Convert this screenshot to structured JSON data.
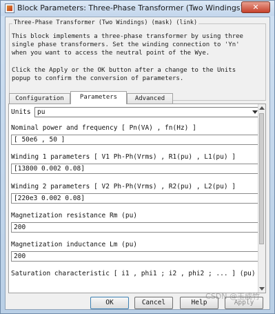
{
  "window": {
    "title": "Block Parameters: Three-Phase Transformer (Two Windings)",
    "close_glyph": "✕"
  },
  "group": {
    "legend": "Three-Phase Transformer (Two Windings) (mask) (link)",
    "description_1": "This block implements a three-phase transformer by using three\nsingle phase transformers. Set the winding connection to 'Yn'\nwhen you want to access the neutral point of the Wye.",
    "description_2": "Click the Apply or the OK button after a change to the Units\npopup to confirm the conversion of parameters."
  },
  "tabs": [
    {
      "label": "Configuration",
      "active": false
    },
    {
      "label": "Parameters",
      "active": true
    },
    {
      "label": "Advanced",
      "active": false
    }
  ],
  "units": {
    "label": "Units",
    "value": "pu"
  },
  "params": [
    {
      "label": "Nominal power and frequency  [ Pn(VA) , fn(Hz) ]",
      "value": "[ 50e6 , 50 ]"
    },
    {
      "label": "Winding 1 parameters [ V1 Ph-Ph(Vrms) , R1(pu) , L1(pu) ]",
      "value": "[13800 0.002 0.08]"
    },
    {
      "label": "Winding 2 parameters [ V2 Ph-Ph(Vrms) , R2(pu) , L2(pu) ]",
      "value": "[220e3 0.002 0.08]"
    },
    {
      "label": "Magnetization resistance  Rm (pu)",
      "value": "200"
    },
    {
      "label": "Magnetization inductance  Lm (pu)",
      "value": "200"
    },
    {
      "label": "Saturation characteristic [ i1 ,  phi1 ;  i2 , phi2 ; ... ] (pu)"
    }
  ],
  "buttons": {
    "ok": "OK",
    "cancel": "Cancel",
    "help": "Help",
    "apply": "Apply"
  },
  "watermark": "CSDN @玉成竹"
}
